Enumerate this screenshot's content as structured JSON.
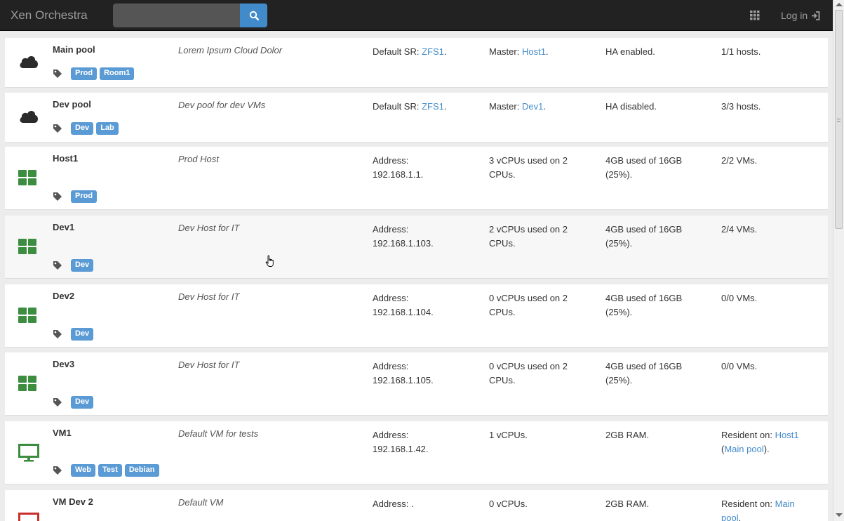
{
  "app": {
    "brand": "Xen Orchestra",
    "login_label": "Log in"
  },
  "search": {
    "placeholder": ""
  },
  "colors": {
    "navbar": "#222222",
    "accent": "#428bca",
    "tag": "#5b9bd5",
    "host_green": "#3c8d40",
    "vm_red": "#c9302c"
  },
  "rows": [
    {
      "icon": "cloud-icon",
      "name": "Main pool",
      "desc": "Lorem Ipsum Cloud Dolor",
      "c1_pre": "Default SR: ",
      "c1_link": "ZFS1",
      "c1_post": ".",
      "c2_pre": "Master: ",
      "c2_link": "Host1",
      "c2_post": ".",
      "c3": "HA enabled.",
      "c4": "1/1 hosts.",
      "tags": [
        "Prod",
        "Room1"
      ]
    },
    {
      "icon": "cloud-icon",
      "name": "Dev pool",
      "desc": "Dev pool for dev VMs",
      "c1_pre": "Default SR: ",
      "c1_link": "ZFS1",
      "c1_post": ".",
      "c2_pre": "Master: ",
      "c2_link": "Dev1",
      "c2_post": ".",
      "c3": "HA disabled.",
      "c4": "3/3 hosts.",
      "tags": [
        "Dev",
        "Lab"
      ]
    },
    {
      "icon": "host-icon",
      "name": "Host1",
      "desc": "Prod Host",
      "c1a": "Address:",
      "c1b": "192.168.1.1.",
      "c2a": "3 vCPUs used on 2",
      "c2b": "CPUs.",
      "c3a": "4GB used of 16GB",
      "c3b": "(25%).",
      "c4": "2/2 VMs.",
      "tags": [
        "Prod"
      ]
    },
    {
      "icon": "host-icon",
      "name": "Dev1",
      "desc": "Dev Host for IT",
      "c1a": "Address:",
      "c1b": "192.168.1.103.",
      "c2a": "2 vCPUs used on 2",
      "c2b": "CPUs.",
      "c3a": "4GB used of 16GB",
      "c3b": "(25%).",
      "c4": "2/4 VMs.",
      "tags": [
        "Dev"
      ]
    },
    {
      "icon": "host-icon",
      "name": "Dev2",
      "desc": "Dev Host for IT",
      "c1a": "Address:",
      "c1b": "192.168.1.104.",
      "c2a": "0 vCPUs used on 2",
      "c2b": "CPUs.",
      "c3a": "4GB used of 16GB",
      "c3b": "(25%).",
      "c4": "0/0 VMs.",
      "tags": [
        "Dev"
      ]
    },
    {
      "icon": "host-icon",
      "name": "Dev3",
      "desc": "Dev Host for IT",
      "c1a": "Address:",
      "c1b": "192.168.1.105.",
      "c2a": "0 vCPUs used on 2",
      "c2b": "CPUs.",
      "c3a": "4GB used of 16GB",
      "c3b": "(25%).",
      "c4": "0/0 VMs.",
      "tags": [
        "Dev"
      ]
    },
    {
      "icon": "monitor-icon",
      "name": "VM1",
      "desc": "Default VM for tests",
      "c1a": "Address:",
      "c1b": "192.168.1.42.",
      "c2": "1 vCPUs.",
      "c3": "2GB RAM.",
      "c4_pre": "Resident on: ",
      "c4_link1": "Host1",
      "c4_mid": "(",
      "c4_link2": "Main pool",
      "c4_post": ").",
      "tags": [
        "Web",
        "Test",
        "Debian"
      ]
    },
    {
      "icon": "monitor-icon",
      "name": "VM Dev 2",
      "desc": "Default VM",
      "c1": "Address: .",
      "c2": "0 vCPUs.",
      "c3": "2GB RAM.",
      "c4_pre": "Resident on: ",
      "c4_link1": "Main",
      "c4_link2": "pool",
      "c4_post": ".",
      "tags": []
    }
  ]
}
